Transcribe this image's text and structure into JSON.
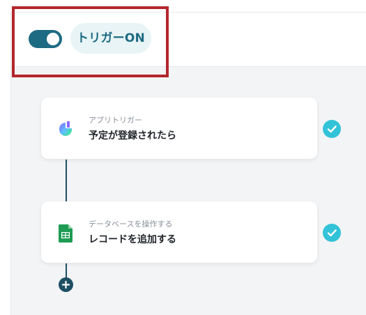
{
  "trigger": {
    "toggle_state": "on",
    "pill_label": "トリガーON"
  },
  "steps": [
    {
      "subtitle": "アプリトリガー",
      "title": "予定が登録されたら",
      "icon": "calendar-app-icon",
      "status": "complete"
    },
    {
      "subtitle": "データベースを操作する",
      "title": "レコードを追加する",
      "icon": "spreadsheet-icon",
      "status": "complete"
    }
  ],
  "add_step": {
    "icon": "plus-icon"
  },
  "colors": {
    "accent": "#1d6b83",
    "pill_bg": "#e8f4f6",
    "check": "#33c3d8",
    "highlight": "#b3272d",
    "sheets_green": "#1e9c53"
  }
}
